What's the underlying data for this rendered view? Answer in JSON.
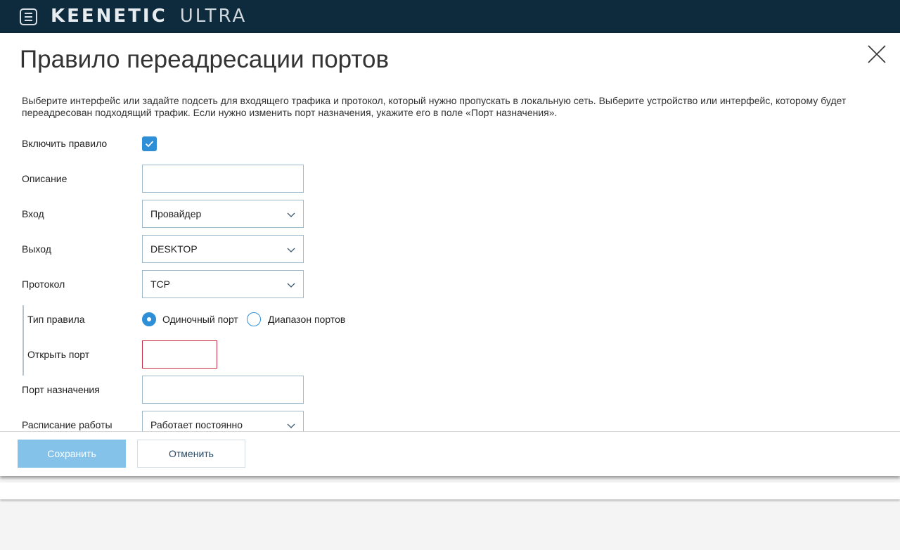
{
  "header": {
    "brand_main": "KEENETIC",
    "brand_model": "ULTRA"
  },
  "modal": {
    "title": "Правило переадресации портов",
    "description": "Выберите интерфейс или задайте подсеть для входящего трафика и протокол, который нужно пропускать в локальную сеть. Выберите устройство или интерфейс, которому будет переадресован подходящий трафик. Если нужно изменить порт назначения, укажите его в поле «Порт назначения».",
    "fields": {
      "enable_rule": {
        "label": "Включить правило",
        "checked": true
      },
      "description": {
        "label": "Описание",
        "value": ""
      },
      "input": {
        "label": "Вход",
        "value": "Провайдер"
      },
      "output": {
        "label": "Выход",
        "value": "DESKTOP"
      },
      "protocol": {
        "label": "Протокол",
        "value": "TCP"
      },
      "rule_type": {
        "label": "Тип правила",
        "options": [
          "Одиночный порт",
          "Диапазон портов"
        ],
        "selected": "Одиночный порт"
      },
      "open_port": {
        "label": "Открыть порт",
        "value": ""
      },
      "dest_port": {
        "label": "Порт назначения",
        "value": ""
      },
      "schedule": {
        "label": "Расписание работы",
        "value": "Работает постоянно"
      }
    },
    "buttons": {
      "save": "Сохранить",
      "cancel": "Отменить"
    }
  },
  "colors": {
    "topbar": "#0e2a3d",
    "accent": "#2f8fd6",
    "save_button": "#84c2ea",
    "error_border": "#c52c46"
  }
}
